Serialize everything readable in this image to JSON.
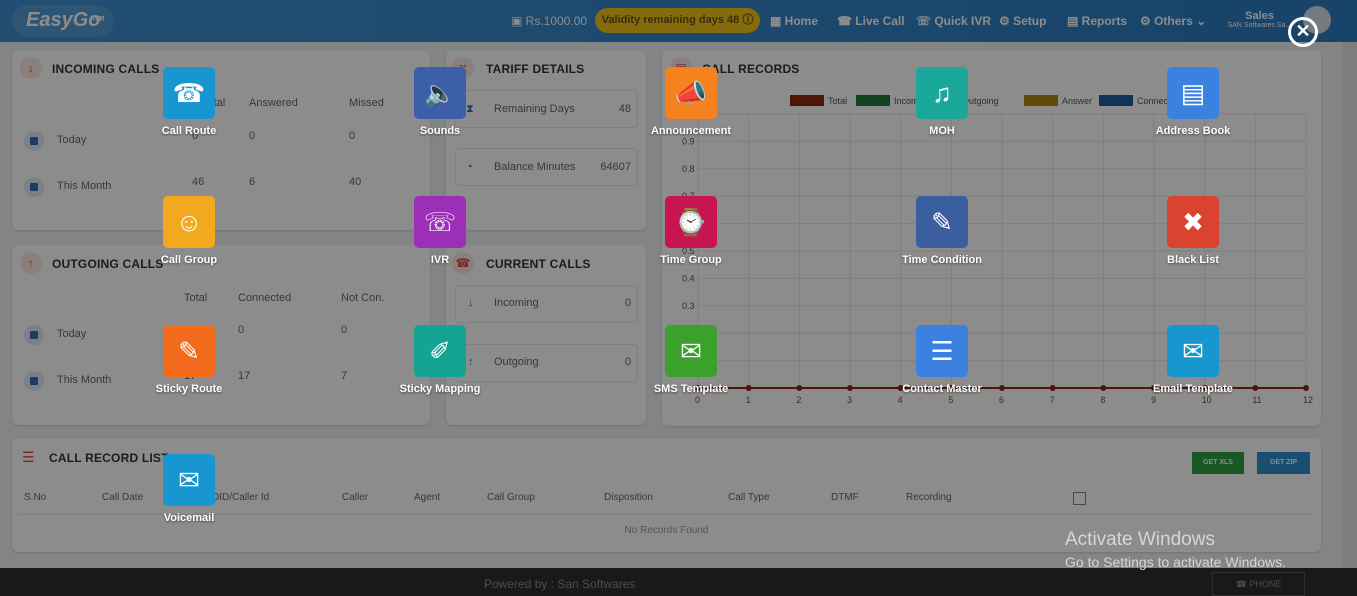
{
  "header": {
    "logo": "EasyGo",
    "logo_sub": "IVR",
    "balance": "Rs.1000.00",
    "validity": "Validity remaining days 48",
    "nav": [
      "Home",
      "Live Call",
      "Quick IVR",
      "Setup",
      "Reports",
      "Others"
    ],
    "user_name": "Sales",
    "user_company": "SAN Softwares Sa..."
  },
  "incoming": {
    "title": "INCOMING CALLS",
    "headers": [
      "Total",
      "Answered",
      "Missed"
    ],
    "rows": [
      {
        "label": "Today",
        "total": "0",
        "answered": "0",
        "missed": "0"
      },
      {
        "label": "This Month",
        "total": "46",
        "answered": "6",
        "missed": "40"
      }
    ]
  },
  "outgoing": {
    "title": "OUTGOING CALLS",
    "headers": [
      "Total",
      "Connected",
      "Not Con."
    ],
    "rows": [
      {
        "label": "Today",
        "total": "0",
        "connected": "0",
        "notcon": "0"
      },
      {
        "label": "This Month",
        "total": "17",
        "connected": "17",
        "notcon": "7"
      }
    ]
  },
  "tariff": {
    "title": "TARIFF DETAILS",
    "remaining_label": "Remaining Days",
    "remaining_value": "48",
    "balance_label": "Balance Minutes",
    "balance_value": "64607"
  },
  "current": {
    "title": "CURRENT CALLS",
    "incoming_label": "Incoming",
    "incoming_value": "0",
    "outgoing_label": "Outgoing",
    "outgoing_value": "0"
  },
  "call_records": {
    "title": "CALL RECORDS",
    "legend": [
      {
        "name": "Total",
        "color": "#8a2b0e"
      },
      {
        "name": "Incoming",
        "color": "#1f7a3a"
      },
      {
        "name": "Outgoing",
        "color": "#1f3fa8"
      },
      {
        "name": "Answer",
        "color": "#b08a12"
      },
      {
        "name": "Connected",
        "color": "#1e5f9e"
      }
    ],
    "y_ticks": [
      "0.9",
      "0.8",
      "0.7",
      "0.6",
      "0.5",
      "0.4",
      "0.3"
    ],
    "x_ticks": [
      "0",
      "1",
      "2",
      "3",
      "4",
      "5",
      "6",
      "7",
      "8",
      "9",
      "10",
      "11",
      "12"
    ]
  },
  "chart_data": {
    "type": "line",
    "x": [
      0,
      1,
      2,
      3,
      4,
      5,
      6,
      7,
      8,
      9,
      10,
      11,
      12
    ],
    "series": [
      {
        "name": "Total",
        "values": [
          0,
          0,
          0,
          0,
          0,
          0,
          0,
          0,
          0,
          0,
          0,
          0,
          0
        ]
      }
    ],
    "title": "",
    "xlabel": "",
    "ylabel": "",
    "ylim": [
      0,
      1
    ],
    "grid": true,
    "legend": "top"
  },
  "record_list": {
    "title": "CALL RECORD LIST",
    "btn_xls": "GET XLS",
    "btn_zip": "GET ZIP",
    "columns": [
      "S.No",
      "Call Date",
      "DID/Caller Id",
      "Caller",
      "Agent",
      "Call Group",
      "Disposition",
      "Call Type",
      "DTMF",
      "Recording"
    ],
    "empty": "No Records Found"
  },
  "footer": {
    "powered": "Powered by : San Softwares",
    "phone": "PHONE"
  },
  "menu": [
    {
      "label": "Call Route",
      "icon": "call-route-icon",
      "color": "#1796cf"
    },
    {
      "label": "Sounds",
      "icon": "speaker-icon",
      "color": "#3d5ea8"
    },
    {
      "label": "Announcement",
      "icon": "megaphone-icon",
      "color": "#f5821f"
    },
    {
      "label": "MOH",
      "icon": "music-note-icon",
      "color": "#1aa89a"
    },
    {
      "label": "Address Book",
      "icon": "address-book-icon",
      "color": "#3b82e0"
    },
    {
      "label": "Call Group",
      "icon": "call-group-icon",
      "color": "#f2a91d"
    },
    {
      "label": "IVR",
      "icon": "ivr-phone-icon",
      "color": "#9b2fb8"
    },
    {
      "label": "Time Group",
      "icon": "time-group-icon",
      "color": "#c8154f"
    },
    {
      "label": "Time Condition",
      "icon": "time-condition-icon",
      "color": "#3b5ea0"
    },
    {
      "label": "Black List",
      "icon": "black-list-icon",
      "color": "#d9432f"
    },
    {
      "label": "Sticky Route",
      "icon": "sticky-route-icon",
      "color": "#f26a1b"
    },
    {
      "label": "Sticky Mapping",
      "icon": "sticky-mapping-icon",
      "color": "#15a394"
    },
    {
      "label": "SMS Template",
      "icon": "sms-template-icon",
      "color": "#3aa12b"
    },
    {
      "label": "Contact Master",
      "icon": "contact-master-icon",
      "color": "#3b82e0"
    },
    {
      "label": "Email Template",
      "icon": "email-template-icon",
      "color": "#1796cf"
    },
    {
      "label": "Voicemail",
      "icon": "voicemail-icon",
      "color": "#1796cf"
    }
  ],
  "watermark": {
    "line1": "Activate Windows",
    "line2": "Go to Settings to activate Windows."
  }
}
